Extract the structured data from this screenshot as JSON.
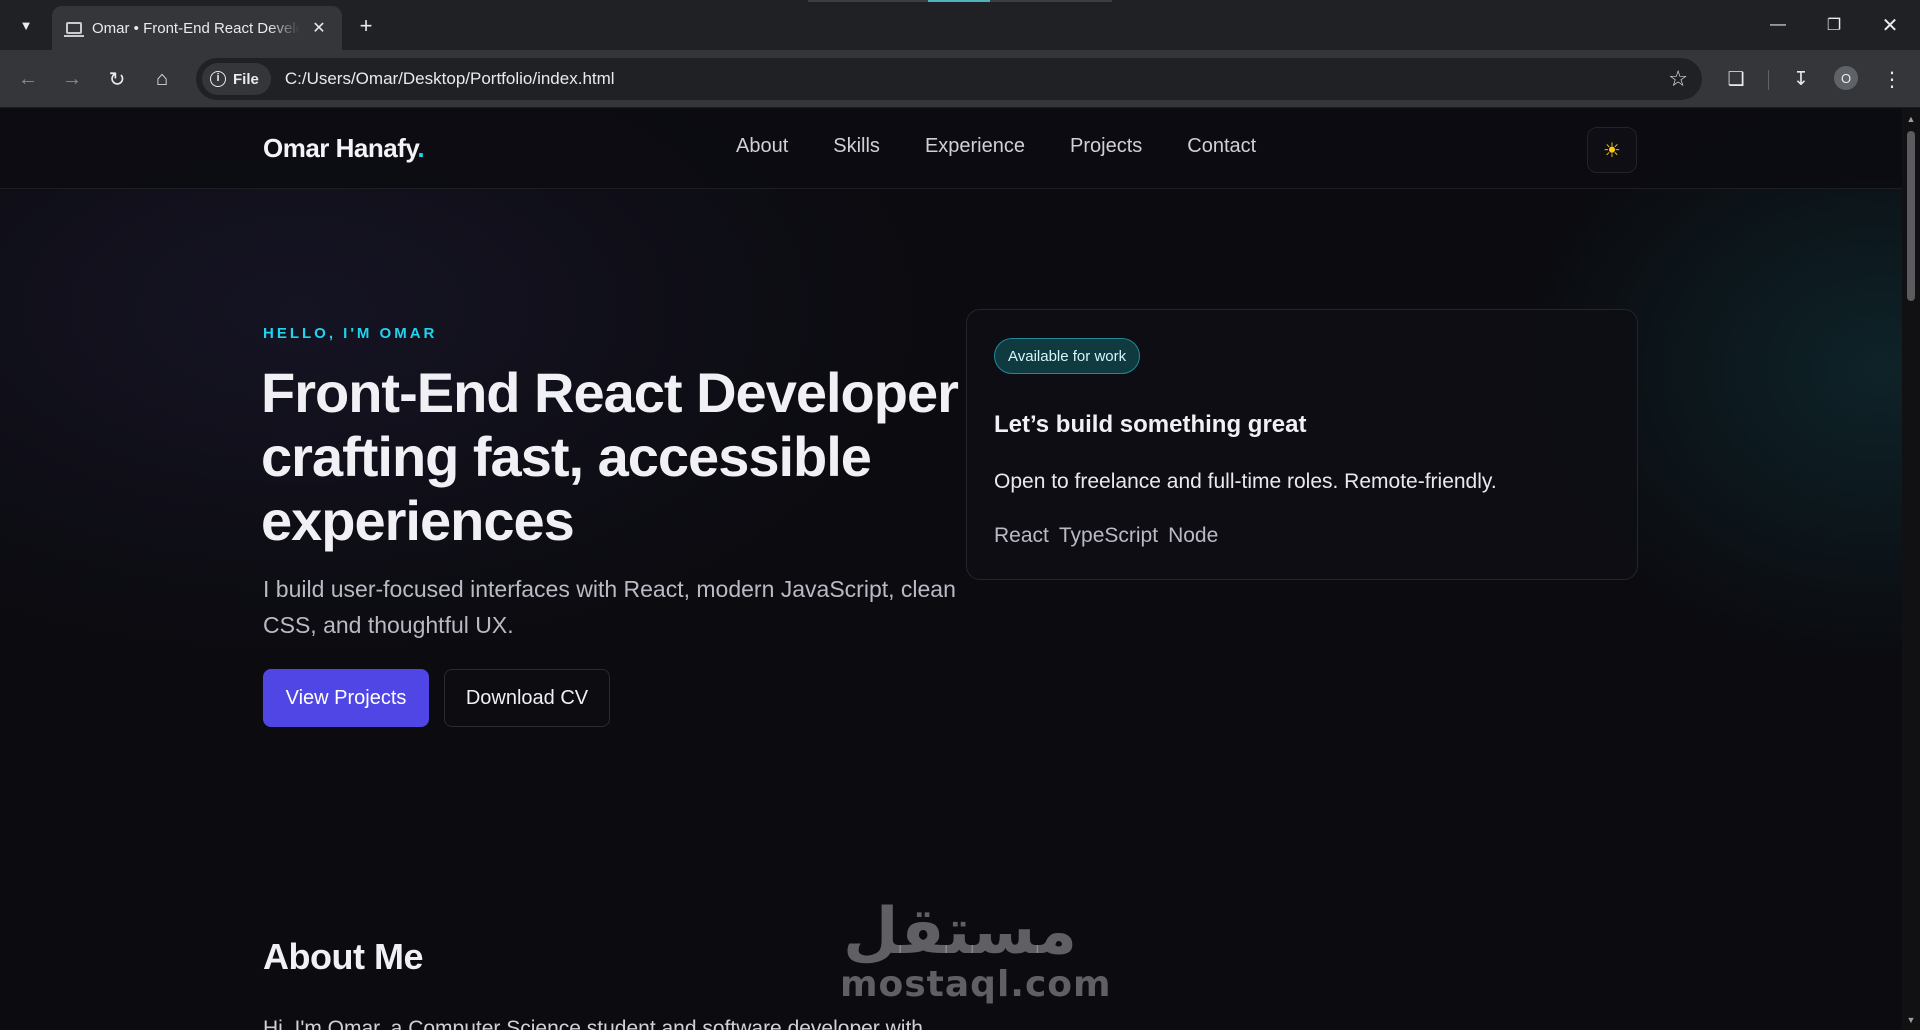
{
  "browser": {
    "tab_title": "Omar • Front-End React Developer",
    "url_scheme": "File",
    "url": "C:/Users/Omar/Desktop/Portfolio/index.html",
    "profile_initial": "O"
  },
  "site": {
    "logo_text": "Omar Hanafy",
    "logo_dot": ".",
    "nav": [
      "About",
      "Skills",
      "Experience",
      "Projects",
      "Contact"
    ],
    "theme_icon": "sun-icon"
  },
  "hero": {
    "eyebrow": "HELLO, I'M OMAR",
    "title": "Front-End React Developer crafting fast, accessible experiences",
    "subtitle": "I build user-focused interfaces with React, modern JavaScript, clean CSS, and thoughtful UX.",
    "primary_button": "View Projects",
    "secondary_button": "Download CV"
  },
  "card": {
    "badge": "Available for work",
    "title": "Let’s build something great",
    "text": "Open to freelance and full-time roles. Remote-friendly.",
    "tech": [
      "React",
      "TypeScript",
      "Node"
    ]
  },
  "about": {
    "title": "About Me",
    "text": "Hi, I'm Omar, a Computer Science student and software developer with"
  },
  "watermark": {
    "arabic": "مستقل",
    "latin": "mostaql.com"
  },
  "colors": {
    "accent_cyan": "#22d3ee",
    "primary_button": "#4f46e5",
    "background": "#0b0b10",
    "badge_bg": "#0f3a40"
  }
}
